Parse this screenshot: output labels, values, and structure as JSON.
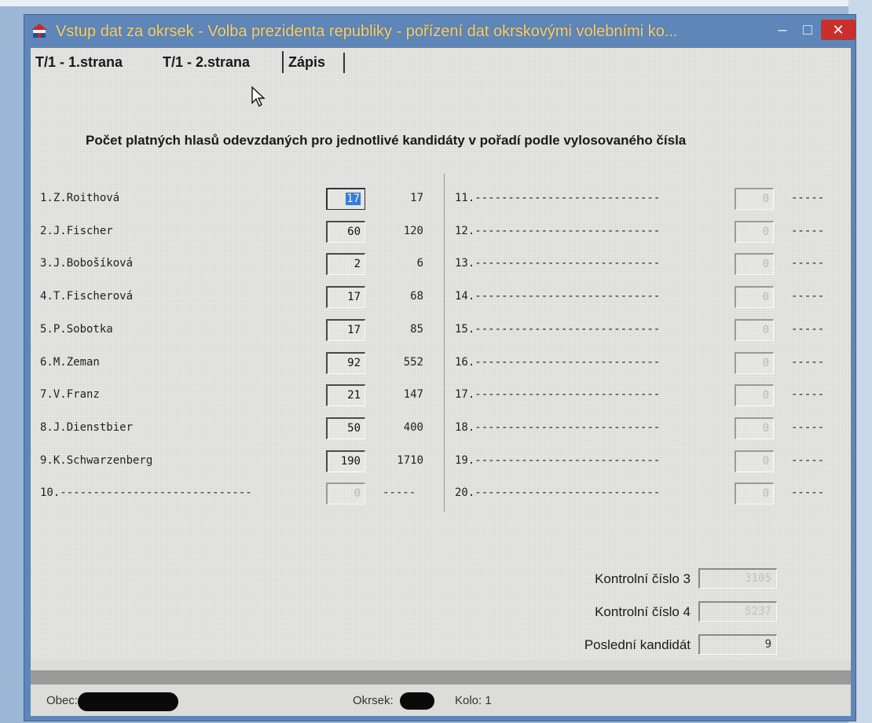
{
  "window": {
    "title": "Vstup dat za okrsek - Volba prezidenta republiky - pořízení dat okrskovými volebními ko...",
    "min_label": "–",
    "max_label": "□",
    "close_label": "✕"
  },
  "tabs": [
    {
      "label": "T/1 - 1.strana"
    },
    {
      "label": "T/1 - 2.strana"
    },
    {
      "label": "Zápis"
    }
  ],
  "heading": "Počet platných hlasů odevzdaných pro jednotlivé kandidáty v pořadí podle vylosovaného čísla",
  "left_candidates": [
    {
      "label": "1.Z.Roithová",
      "votes": "17",
      "product": "17",
      "selected": true
    },
    {
      "label": "2.J.Fischer",
      "votes": "60",
      "product": "120"
    },
    {
      "label": "3.J.Bobošíková",
      "votes": "2",
      "product": "6"
    },
    {
      "label": "4.T.Fischerová",
      "votes": "17",
      "product": "68"
    },
    {
      "label": "5.P.Sobotka",
      "votes": "17",
      "product": "85"
    },
    {
      "label": "6.M.Zeman",
      "votes": "92",
      "product": "552"
    },
    {
      "label": "7.V.Franz",
      "votes": "21",
      "product": "147"
    },
    {
      "label": "8.J.Dienstbier",
      "votes": "50",
      "product": "400"
    },
    {
      "label": "9.K.Schwarzenberg",
      "votes": "190",
      "product": "1710"
    },
    {
      "label": "10.-----------------------------",
      "votes": "0",
      "product": "-----",
      "disabled": true
    }
  ],
  "right_candidates": [
    {
      "label": "11.----------------------------",
      "votes": "0",
      "product": "-----"
    },
    {
      "label": "12.----------------------------",
      "votes": "0",
      "product": "-----"
    },
    {
      "label": "13.----------------------------",
      "votes": "0",
      "product": "-----"
    },
    {
      "label": "14.----------------------------",
      "votes": "0",
      "product": "-----"
    },
    {
      "label": "15.----------------------------",
      "votes": "0",
      "product": "-----"
    },
    {
      "label": "16.----------------------------",
      "votes": "0",
      "product": "-----"
    },
    {
      "label": "17.----------------------------",
      "votes": "0",
      "product": "-----"
    },
    {
      "label": "18.----------------------------",
      "votes": "0",
      "product": "-----"
    },
    {
      "label": "19.----------------------------",
      "votes": "0",
      "product": "-----"
    },
    {
      "label": "20.----------------------------",
      "votes": "0",
      "product": "-----"
    }
  ],
  "controls": {
    "kontrolni3_label": "Kontrolní číslo 3",
    "kontrolni3_value": "3105",
    "kontrolni4_label": "Kontrolní číslo 4",
    "kontrolni4_value": "5237",
    "posledni_label": "Poslední kandidát",
    "posledni_value": "9"
  },
  "status": {
    "obec_label": "Obec:",
    "okrsek_label": "Okrsek:",
    "kolo_label": "Kolo: 1"
  },
  "colors": {
    "window_frame": "#5f86b8",
    "title_text": "#f2d27a",
    "close_button": "#c9302c",
    "selection": "#3a7bd5"
  }
}
